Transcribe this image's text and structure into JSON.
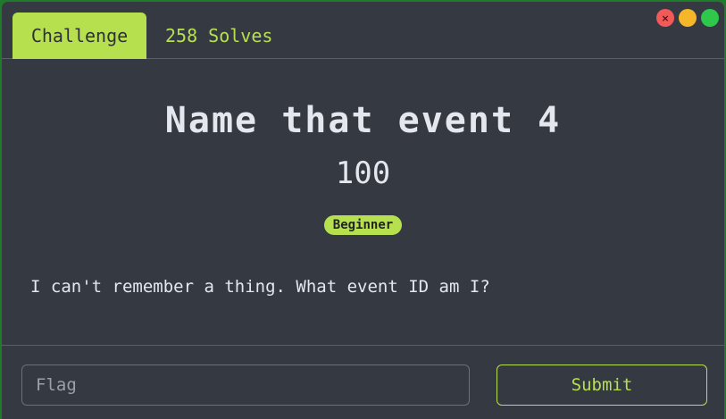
{
  "tabs": {
    "challenge_label": "Challenge",
    "solves_label": "258 Solves"
  },
  "window_controls": {
    "close_glyph": "×",
    "icons": [
      "close-icon",
      "minimize-icon",
      "maximize-icon"
    ],
    "colors": {
      "close": "#f25a5a",
      "minimize": "#f5b629",
      "maximize": "#2ec94a"
    }
  },
  "challenge": {
    "title": "Name that event 4",
    "points": "100",
    "category_badge": "Beginner",
    "description": "I can't remember a thing. What event ID am I?"
  },
  "form": {
    "flag_placeholder": "Flag",
    "flag_value": "",
    "submit_label": "Submit"
  },
  "colors": {
    "accent": "#b7e04f",
    "background": "#353a42",
    "text": "#e4e8ee"
  }
}
